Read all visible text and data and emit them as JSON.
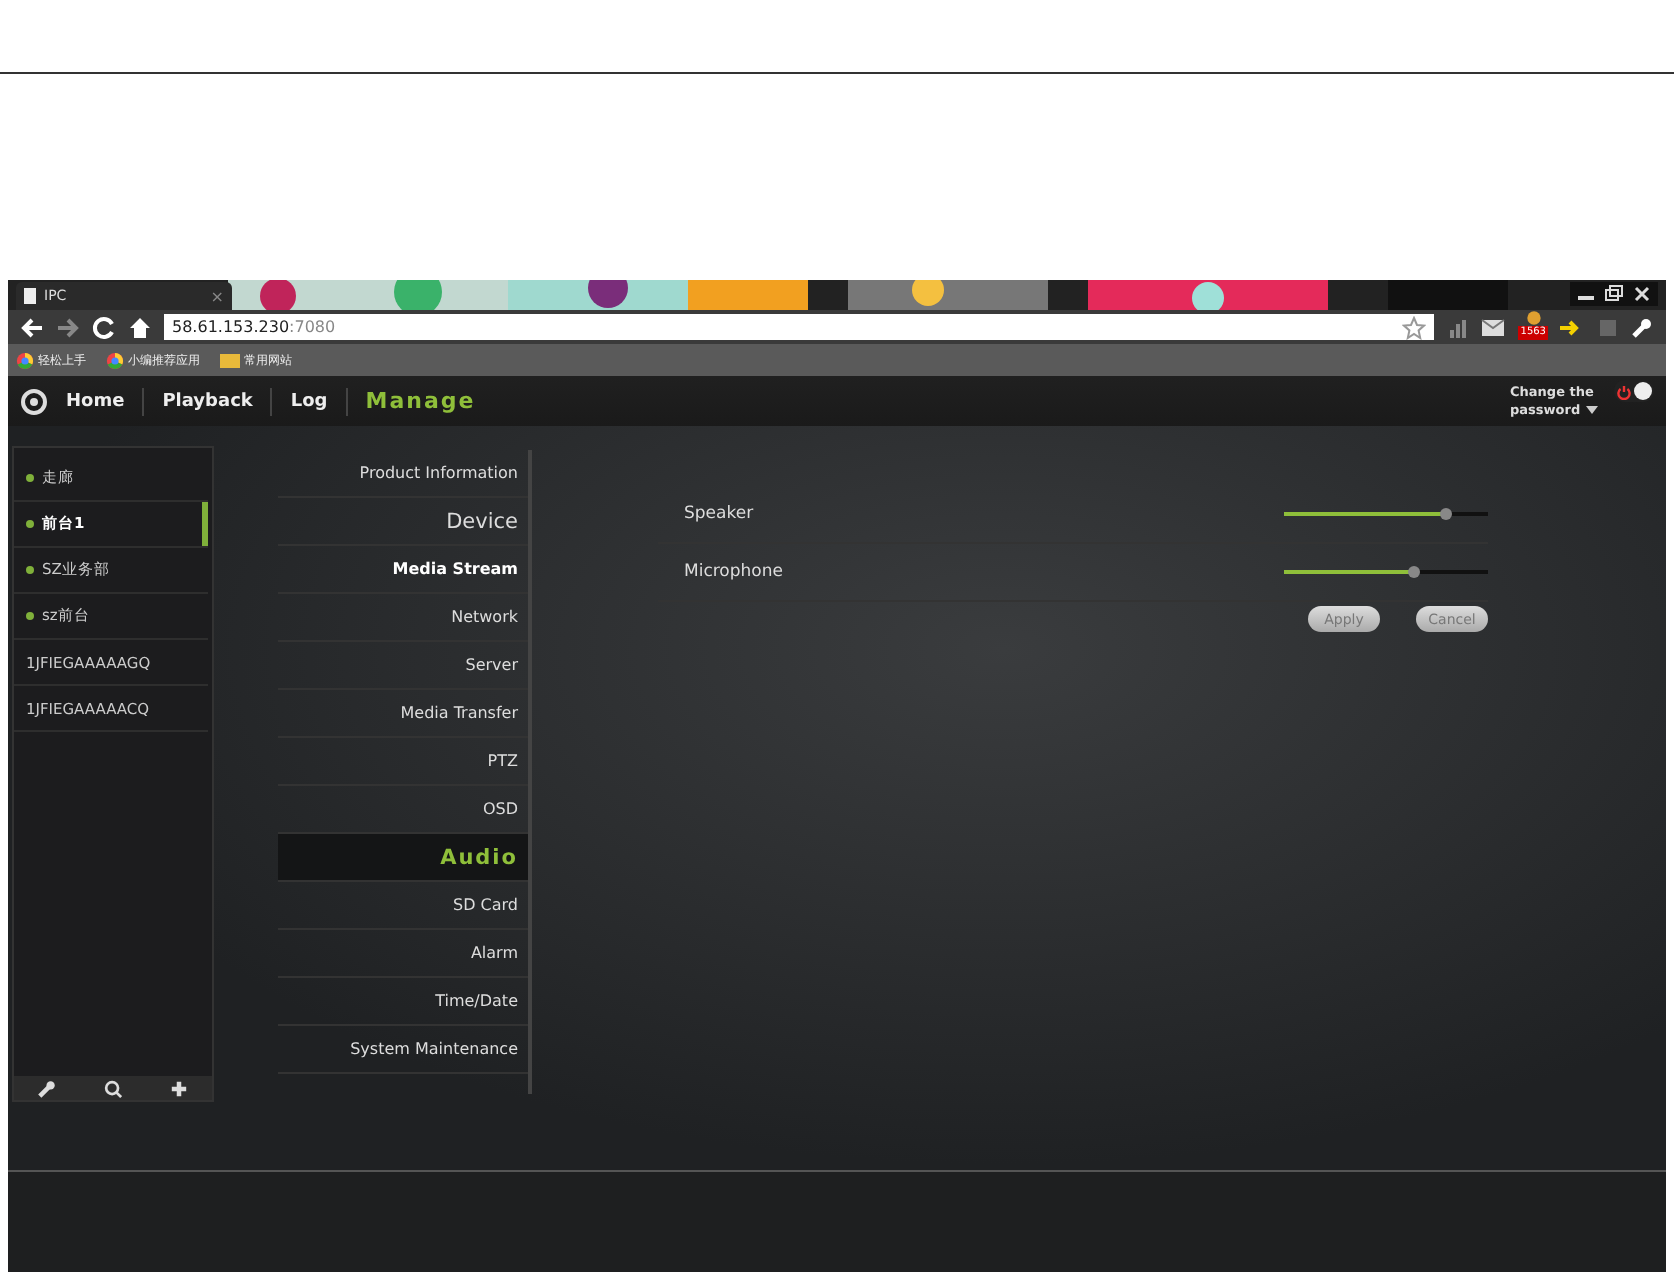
{
  "browser": {
    "tab_title": "IPC",
    "tab_close": "×",
    "address": "58.61.153.230",
    "port": ":7080",
    "badge": "1563",
    "bookmarks": [
      "轻松上手",
      "小编推荐应用",
      "常用网站"
    ]
  },
  "nav": {
    "items": [
      {
        "label": "Home",
        "selected": false
      },
      {
        "label": "Playback",
        "selected": false
      },
      {
        "label": "Log",
        "selected": false
      },
      {
        "label": "Manage",
        "selected": true
      }
    ],
    "account": "Change the password",
    "power_on": true
  },
  "devices": [
    {
      "name": "走廊",
      "online": true,
      "selected": false
    },
    {
      "name": "前台1",
      "online": true,
      "selected": true
    },
    {
      "name": "SZ业务部",
      "online": true,
      "selected": false
    },
    {
      "name": "sz前台",
      "online": true,
      "selected": false
    },
    {
      "name": "1JFIEGAAAAAGQ",
      "online": false,
      "selected": false
    },
    {
      "name": "1JFIEGAAAAACQ",
      "online": false,
      "selected": false
    }
  ],
  "menu": [
    {
      "label": "Product Information",
      "kind": "item",
      "selected": false
    },
    {
      "label": "Device",
      "kind": "group",
      "selected": false
    },
    {
      "label": "Media Stream",
      "kind": "strong",
      "selected": false
    },
    {
      "label": "Network",
      "kind": "item",
      "selected": false
    },
    {
      "label": "Server",
      "kind": "item",
      "selected": false
    },
    {
      "label": "Media Transfer",
      "kind": "item",
      "selected": false
    },
    {
      "label": "PTZ",
      "kind": "item",
      "selected": false
    },
    {
      "label": "OSD",
      "kind": "item",
      "selected": false
    },
    {
      "label": "Audio",
      "kind": "item",
      "selected": true
    },
    {
      "label": "SD Card",
      "kind": "item",
      "selected": false
    },
    {
      "label": "Alarm",
      "kind": "item",
      "selected": false
    },
    {
      "label": "Time/Date",
      "kind": "item",
      "selected": false
    },
    {
      "label": "System Maintenance",
      "kind": "item",
      "selected": false
    }
  ],
  "audio": {
    "channels": [
      {
        "name": "Speaker",
        "level": 0.79
      },
      {
        "name": "Microphone",
        "level": 0.64
      }
    ],
    "buttons": [
      "Apply",
      "Cancel"
    ]
  }
}
